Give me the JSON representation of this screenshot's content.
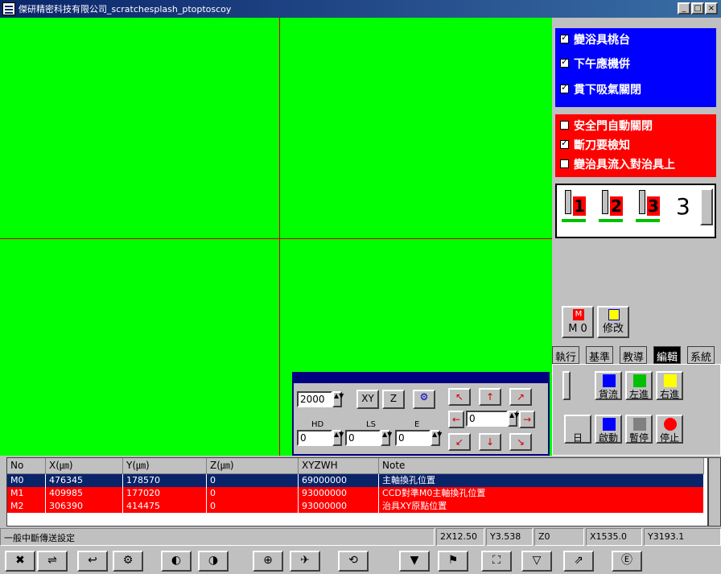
{
  "window": {
    "title": "傑研精密科技有限公司_scratchesplash_ptoptoscoy",
    "controls": [
      "_",
      "□",
      "×"
    ]
  },
  "right_panel": {
    "blue_checks": [
      {
        "label": "變浴具桃台",
        "checked": true
      },
      {
        "label": "下午應機倂",
        "checked": true
      },
      {
        "label": "貫下吸氣關閉",
        "checked": true
      }
    ],
    "red_checks": [
      {
        "label": "安全門自動關閉",
        "checked": false
      },
      {
        "label": "斷刀要檢知",
        "checked": true
      },
      {
        "label": "變治具流入對治具上",
        "checked": false
      }
    ],
    "tools": [
      "1",
      "2",
      "3"
    ],
    "tool_count": "3",
    "m0_button": {
      "top": "M",
      "label": "M 0"
    },
    "edit_button": {
      "label": "修改"
    },
    "tabs": [
      "執行",
      "基準",
      "教導",
      "編輯",
      "系統"
    ],
    "tab_buttons": [
      {
        "label": "貨流"
      },
      {
        "label": "左進"
      },
      {
        "label": "右進"
      },
      {
        "label": "日"
      },
      {
        "label": "啟動"
      },
      {
        "label": "暫停"
      },
      {
        "label": "停止"
      }
    ]
  },
  "jog": {
    "speed": "2000",
    "xy_label": "XY",
    "z_label": "Z",
    "step_value": "0",
    "labels": [
      "HD",
      "LS",
      "E"
    ],
    "values": [
      "0",
      "0",
      "0"
    ],
    "arrows": [
      "↖",
      "↑",
      "↗",
      "←",
      "→",
      "↙",
      "↓",
      "↘"
    ]
  },
  "table": {
    "headers": [
      "No",
      "X(㎛)",
      "Y(㎛)",
      "Z(㎛)",
      "XYZWH",
      "Note"
    ],
    "rows": [
      {
        "no": "M0",
        "x": "476345",
        "y": "178570",
        "z": "0",
        "xyzwh": "69000000",
        "note": "主軸換孔位置",
        "color": "#0a246a"
      },
      {
        "no": "M1",
        "x": "409985",
        "y": "177020",
        "z": "0",
        "xyzwh": "93000000",
        "note": "CCD對準M0主軸換孔位置",
        "color": "#ff0000"
      },
      {
        "no": "M2",
        "x": "306390",
        "y": "414475",
        "z": "0",
        "xyzwh": "93000000",
        "note": "治具XY原點位置",
        "color": "#ff0000"
      }
    ]
  },
  "status": {
    "left": "一般中斷傳送設定",
    "cells": [
      "2X12.50",
      "Y3.538",
      "Z0",
      "X1535.0",
      "Y3193.1"
    ]
  },
  "bottom_toolbar": [
    "✖",
    "⇌",
    "↩",
    "⚙",
    "◐",
    "◑",
    "⊕",
    "✈",
    "⟲",
    "▼",
    "⚑",
    "⛶",
    "▽",
    "⇗",
    "Ⓔ"
  ],
  "colors": {
    "camera": "#00ff00",
    "crosshair": "#d00000",
    "blue": "#0000ff",
    "red": "#ff0000",
    "navy": "#0a246a"
  }
}
